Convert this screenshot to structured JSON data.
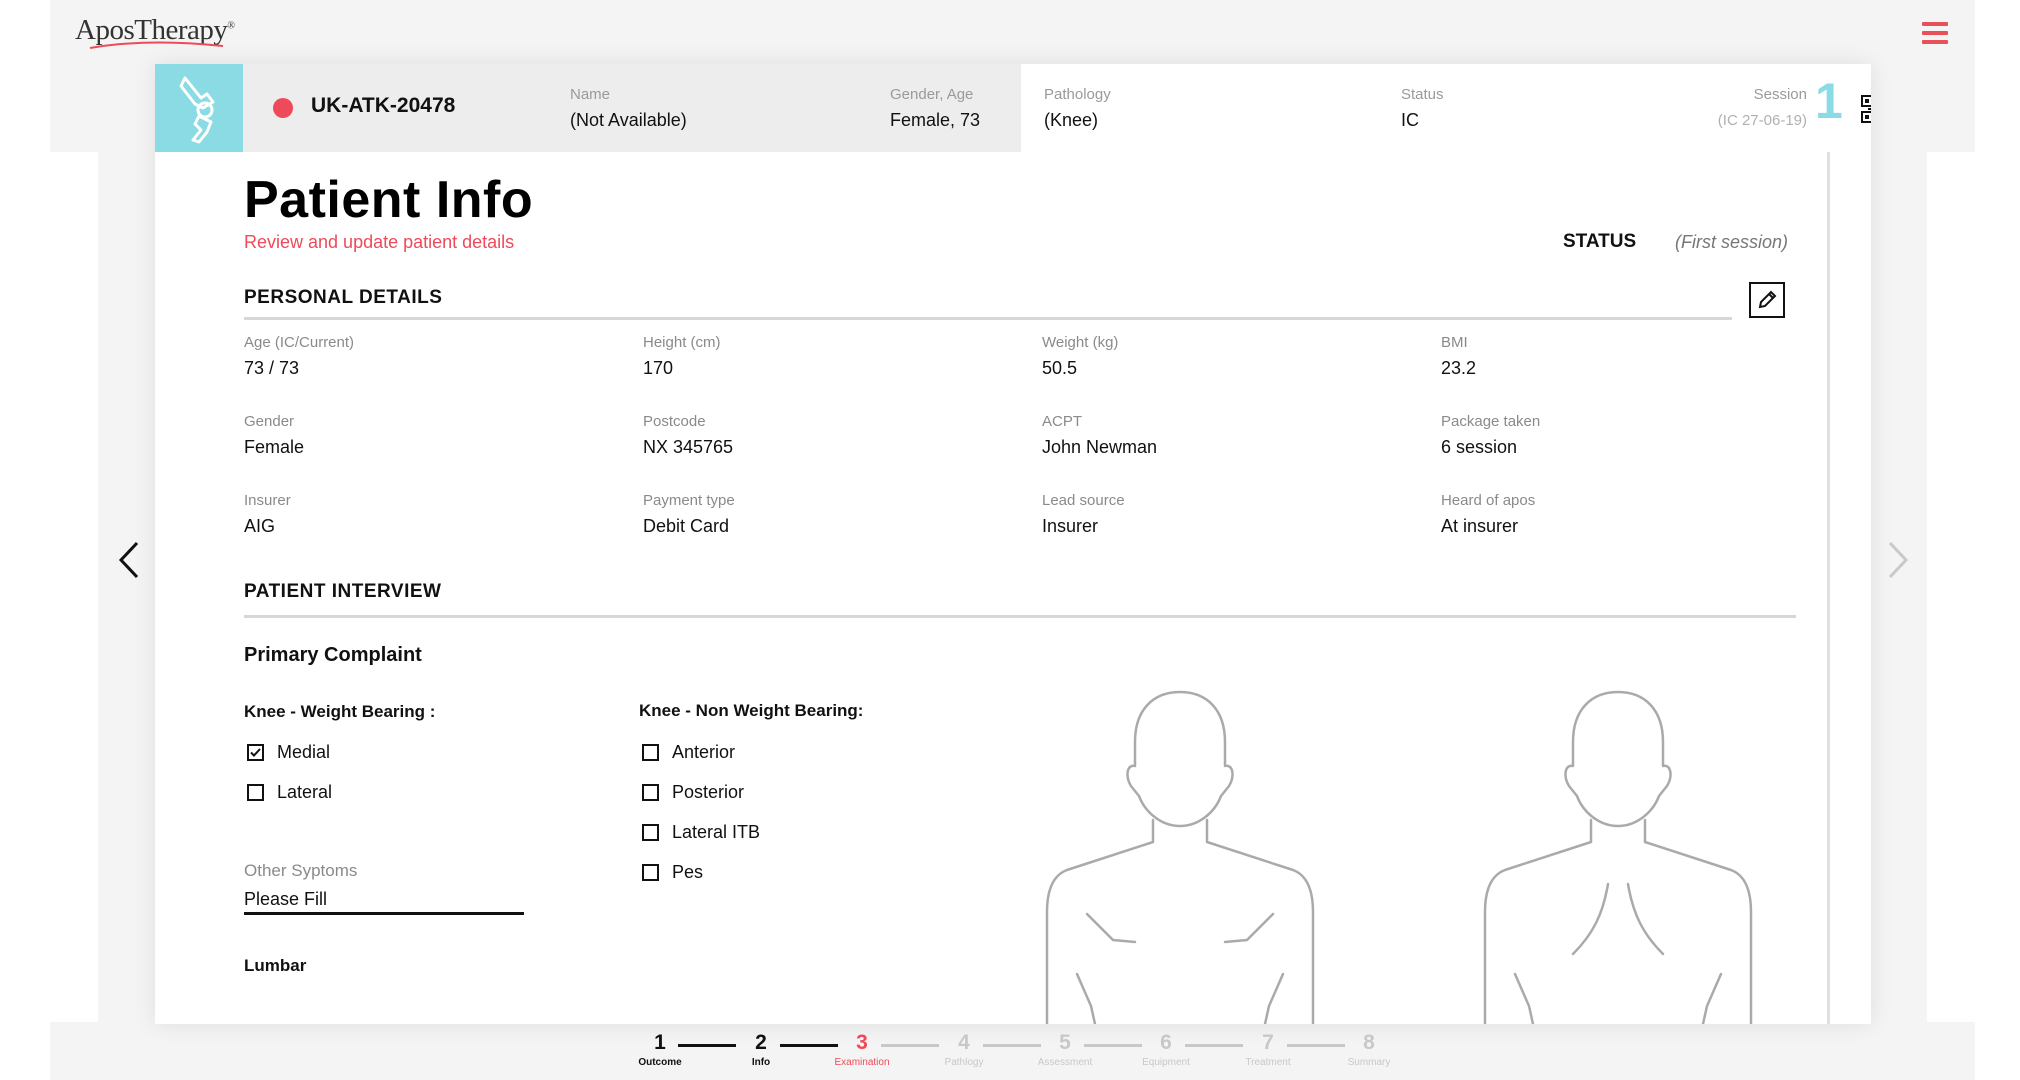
{
  "app": {
    "logo_text": "AposTherapy",
    "logo_tm": "®",
    "accent_color": "#ee4a59",
    "brand_color": "#8adbe3"
  },
  "header": {
    "patient_id": "UK-ATK-20478",
    "status_dot_color": "#ee4a59",
    "name_label": "Name",
    "name_value": "(Not Available)",
    "gender_age_label": "Gender, Age",
    "gender_age_value": "Female, 73",
    "pathology_label": "Pathology",
    "pathology_value": "(Knee)",
    "status_label": "Status",
    "status_value": "IC",
    "session_label": "Session",
    "session_value": "(IC 27-06-19)",
    "session_number": "1"
  },
  "page": {
    "title": "Patient Info",
    "subtitle": "Review and update patient details",
    "status_label": "STATUS",
    "status_value": "(First session)"
  },
  "personal_details": {
    "title": "PERSONAL DETAILS",
    "fields": [
      {
        "label": "Age (IC/Current)",
        "value": "73 / 73"
      },
      {
        "label": "Height (cm)",
        "value": "170"
      },
      {
        "label": "Weight (kg)",
        "value": "50.5"
      },
      {
        "label": "BMI",
        "value": "23.2"
      },
      {
        "label": "Gender",
        "value": "Female"
      },
      {
        "label": "Postcode",
        "value": "NX 345765"
      },
      {
        "label": "ACPT",
        "value": "John Newman"
      },
      {
        "label": "Package taken",
        "value": "6 session"
      },
      {
        "label": "Insurer",
        "value": "AIG"
      },
      {
        "label": "Payment type",
        "value": "Debit Card"
      },
      {
        "label": "Lead source",
        "value": "Insurer"
      },
      {
        "label": "Heard of apos",
        "value": "At insurer"
      }
    ]
  },
  "interview": {
    "title": "PATIENT INTERVIEW",
    "primary_complaint": "Primary Complaint",
    "weight_bearing": {
      "title": "Knee - Weight Bearing :",
      "options": [
        {
          "label": "Medial",
          "checked": true
        },
        {
          "label": "Lateral",
          "checked": false
        }
      ]
    },
    "non_weight_bearing": {
      "title": "Knee - Non Weight Bearing:",
      "options": [
        {
          "label": "Anterior",
          "checked": false
        },
        {
          "label": "Posterior",
          "checked": false
        },
        {
          "label": "Lateral ITB",
          "checked": false
        },
        {
          "label": "Pes",
          "checked": false
        }
      ]
    },
    "other_symptoms_label": "Other Syptoms",
    "other_symptoms_value": "Please Fill",
    "lumbar_label": "Lumbar"
  },
  "stepper": {
    "steps": [
      {
        "num": "1",
        "label": "Outcome",
        "state": "done"
      },
      {
        "num": "2",
        "label": "Info",
        "state": "done"
      },
      {
        "num": "3",
        "label": "Examination",
        "state": "active"
      },
      {
        "num": "4",
        "label": "Pathlogy",
        "state": "todo"
      },
      {
        "num": "5",
        "label": "Assessment",
        "state": "todo"
      },
      {
        "num": "6",
        "label": "Equipment",
        "state": "todo"
      },
      {
        "num": "7",
        "label": "Treatment",
        "state": "todo"
      },
      {
        "num": "8",
        "label": "Summary",
        "state": "todo"
      }
    ]
  }
}
